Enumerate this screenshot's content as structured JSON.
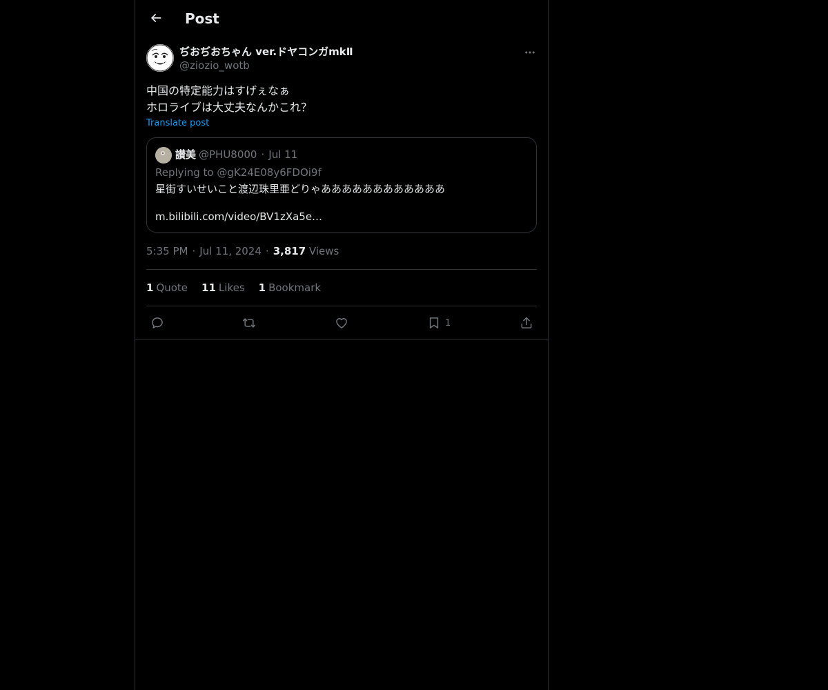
{
  "header": {
    "title": "Post",
    "back_icon": "arrow-left-icon"
  },
  "post": {
    "author": {
      "display_name": "ぢおぢおちゃん ver.ドヤコンガmkⅡ",
      "handle": "@ziozio_wotb"
    },
    "text": "中国の特定能力はすげぇなぁ\nホロライブは大丈夫なんかこれ？",
    "translate_label": "Translate post",
    "quote": {
      "author_name": "讃美",
      "author_handle": "@PHU8000",
      "date": "Jul 11",
      "separator": "·",
      "replying_to": "Replying to @gK24E08y6FDOi9f",
      "text": "星街すいせいこと渡辺珠里亜どりゃああああああああああああ",
      "link": "m.bilibili.com/video/BV1zXa5e…"
    },
    "time": "5:35 PM",
    "date": "Jul 11, 2024",
    "separator": "·",
    "views_count": "3,817",
    "views_label": "Views",
    "stats": {
      "quotes_count": "1",
      "quotes_label": "Quote",
      "likes_count": "11",
      "likes_label": "Likes",
      "bookmarks_count": "1",
      "bookmarks_label": "Bookmark"
    },
    "actions": {
      "reply_icon": "reply-icon",
      "repost_icon": "repost-icon",
      "like_icon": "heart-icon",
      "bookmark_icon": "bookmark-icon",
      "bookmark_count": "1",
      "share_icon": "share-icon"
    }
  },
  "colors": {
    "background": "#000000",
    "text_primary": "#e7e9ea",
    "text_secondary": "#71767b",
    "link": "#1d9bf0",
    "border": "#2f3336"
  }
}
